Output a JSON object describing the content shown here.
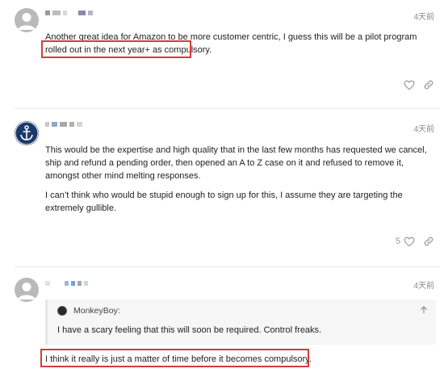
{
  "posts": [
    {
      "date": "4天前",
      "paragraphs": [
        "Another great idea for Amazon to be more customer centric, I guess this will be a pilot program rolled out in the next year+ as compulsory."
      ]
    },
    {
      "date": "4天前",
      "paragraphs": [
        "This would be the expertise and high quality that in the last few months has requested we cancel, ship and refund a pending order, then opened an A to Z case on it and refused to remove it, amongst other mind melting responses.",
        "I can’t think who would be stupid enough to sign up for this, I assume they are targeting the extremely gullible."
      ],
      "like_count": "5"
    },
    {
      "date": "4天前",
      "quote": {
        "author": "MonkeyBoy:",
        "text": "I have a scary feeling that this will soon be required. Control freaks."
      },
      "paragraphs": [
        "I think it really is just a matter of time before it becomes compulsory."
      ]
    }
  ],
  "colors": {
    "highlight": "#d63a3a",
    "muted": "#8a8a8a",
    "anchor_avatar_bg": "#1b3a6b"
  },
  "icons": [
    "default-avatar-icon",
    "anchor-avatar-icon",
    "heart-icon",
    "link-icon",
    "chevron-up-icon"
  ]
}
